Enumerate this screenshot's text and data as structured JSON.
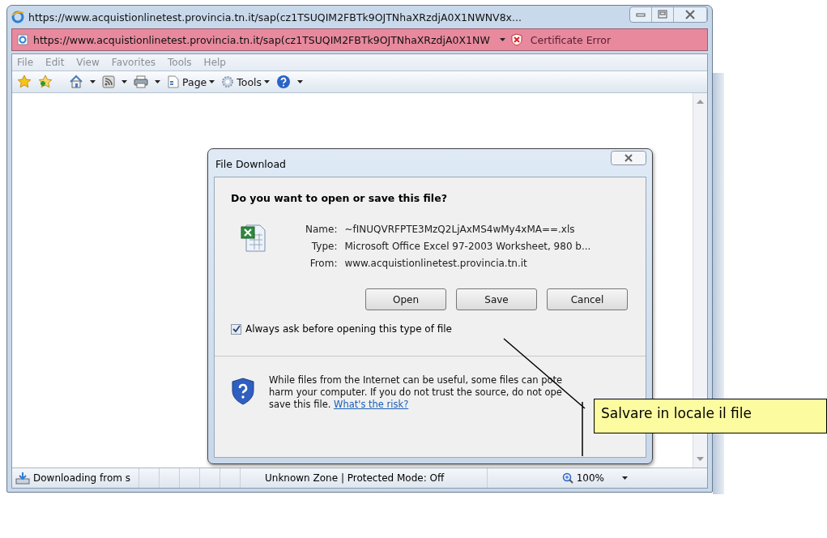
{
  "browser": {
    "title": "https://www.acquistionlinetest.provincia.tn.it/sap(cz1TSUQIM2FBTk9OJTNhaXRzdjA0X1NWNV8x...",
    "address": "https://www.acquistionlinetest.provincia.tn.it/sap(cz1TSUQIM2FBTk9OJTNhaXRzdjA0X1NW",
    "certificate_error": "Certificate Error",
    "menu": [
      "File",
      "Edit",
      "View",
      "Favorites",
      "Tools",
      "Help"
    ],
    "toolbar": [
      {
        "kind": "page",
        "label": "Page"
      },
      {
        "kind": "tools",
        "label": "Tools"
      }
    ],
    "status_bar": {
      "download": "Downloading from s",
      "zone": "Unknown Zone | Protected Mode: Off",
      "zoom": "100%"
    }
  },
  "dialog": {
    "title": "File Download",
    "question": "Do you want to open or save this file?",
    "fields": [
      {
        "label": "Name:",
        "value": "~fINUQVRFPTE3MzQ2LjAxMS4wMy4xMA==.xls"
      },
      {
        "label": "Type:",
        "value": "Microsoft Office Excel 97-2003 Worksheet, 980 b..."
      },
      {
        "label": "From:",
        "value": "www.acquistionlinetest.provincia.tn.it"
      }
    ],
    "buttons": [
      "Open",
      "Save",
      "Cancel"
    ],
    "always_ask": {
      "label": "Always ask before opening this type of file",
      "checked": true
    },
    "warning": {
      "lines": [
        "While files from the Internet can be useful, some files can pote",
        "harm your computer. If you do not trust the source, do not ope",
        "save this file."
      ],
      "link": "What's the risk?"
    }
  },
  "callout": {
    "text": "Salvare in locale il file"
  }
}
